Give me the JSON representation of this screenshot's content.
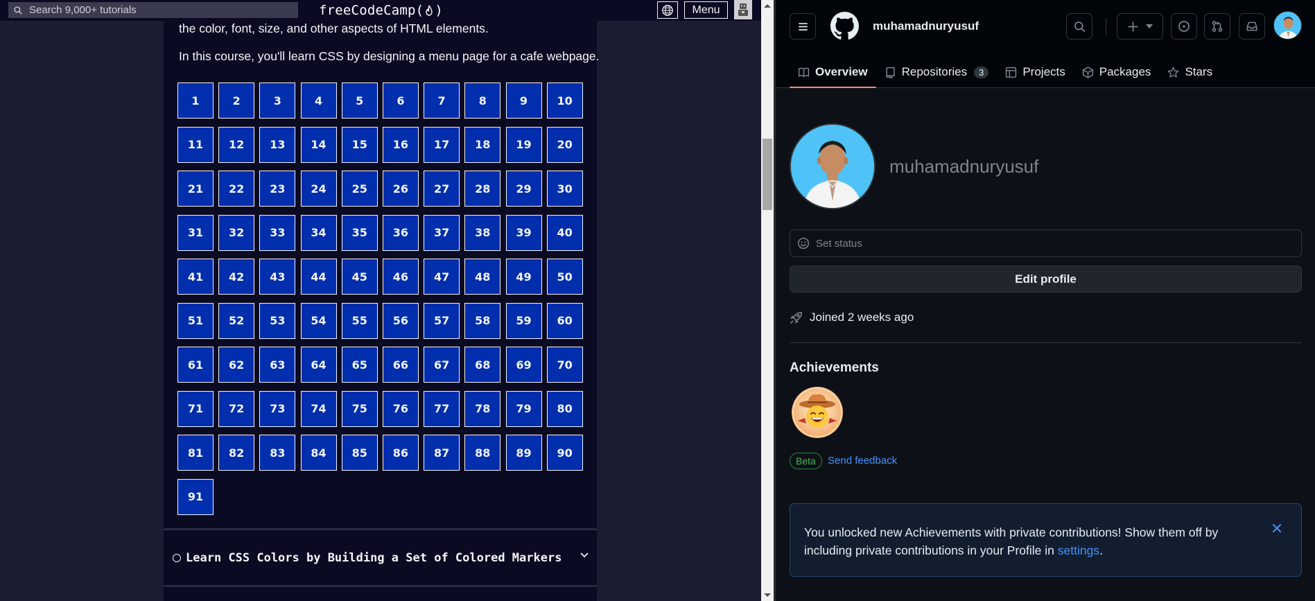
{
  "fcc": {
    "search_placeholder": "Search 9,000+ tutorials",
    "logo_text_left": "freeCodeCamp(",
    "logo_text_right": ")",
    "menu_label": "Menu",
    "description_line1": "the color, font, size, and other aspects of HTML elements.",
    "description_line2": "In this course, you'll learn CSS by designing a menu page for a cafe webpage.",
    "step_count": 91,
    "next_block_title": "Learn CSS Colors by Building a Set of Colored Markers",
    "icons": [
      "search-icon",
      "flame-icon",
      "globe-icon",
      "avatar-icon",
      "circle-icon",
      "chevron-down-icon"
    ],
    "colors": {
      "background": "#0a0a23",
      "sidebar": "#1b1b32",
      "step_fill": "#002ead",
      "text": "#f5f6f7"
    }
  },
  "gh": {
    "username": "muhamadnuryusuf",
    "tabs": [
      {
        "label": "Overview",
        "icon": "book-icon",
        "active": true
      },
      {
        "label": "Repositories",
        "icon": "repo-icon",
        "counter": "3"
      },
      {
        "label": "Projects",
        "icon": "table-icon"
      },
      {
        "label": "Packages",
        "icon": "package-icon"
      },
      {
        "label": "Stars",
        "icon": "star-icon"
      }
    ],
    "profile_name": "muhamadnuryusuf",
    "status_placeholder": "Set status",
    "edit_profile_label": "Edit profile",
    "joined_text": "Joined 2 weeks ago",
    "achievements_title": "Achievements",
    "beta_label": "Beta",
    "feedback_link": "Send feedback",
    "flash_text_before": "You unlocked new Achievements with private contributions! Show them off by including private contributions in your Profile in ",
    "flash_link": "settings",
    "flash_text_after": ".",
    "icons": [
      "hamburger-icon",
      "github-logo",
      "search-icon",
      "plus-icon",
      "issue-icon",
      "pull-request-icon",
      "inbox-icon",
      "smiley-icon",
      "rocket-icon",
      "close-icon"
    ],
    "colors": {
      "background": "#0d1117",
      "header": "#010409",
      "border": "#30363d",
      "active_tab": "#fd8c73",
      "link": "#4493f8",
      "beta": "#3fb950"
    }
  }
}
